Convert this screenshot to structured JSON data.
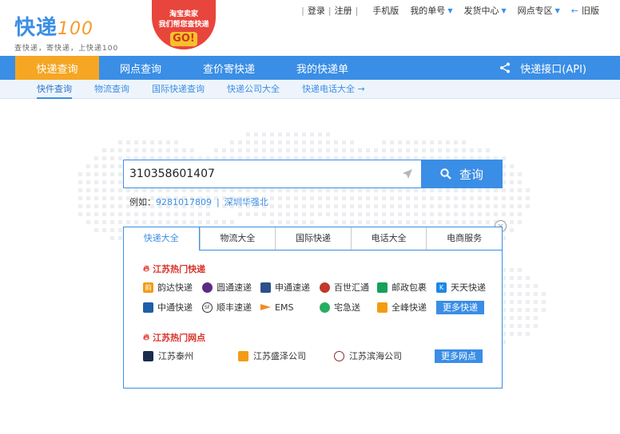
{
  "logo": {
    "main": "快递",
    "num": "100",
    "tagline": "查快递，寄快递，上快递100"
  },
  "promo": {
    "line1": "淘宝卖家",
    "line2": "我们帮您查快递",
    "go": "GO!"
  },
  "topbar": {
    "login": "登录",
    "register": "注册",
    "mobile": "手机版",
    "my_orders": "我的单号",
    "sender_center": "发货中心",
    "outlet_zone": "网点专区",
    "old_version": "旧版"
  },
  "nav": {
    "tabs": [
      "快递查询",
      "网点查询",
      "查价寄快递",
      "我的快递单"
    ],
    "api": "快递接口(API)"
  },
  "subnav": [
    "快件查询",
    "物流查询",
    "国际快递查询",
    "快递公司大全",
    "快递电话大全 →"
  ],
  "search": {
    "value": "310358601407",
    "button": "查询"
  },
  "example": {
    "label": "例如：",
    "number": "9281017809",
    "place": "深圳华强北"
  },
  "panel": {
    "close": "×",
    "tabs": [
      "快递大全",
      "物流大全",
      "国际快递",
      "电话大全",
      "电商服务"
    ],
    "hot_express_title": "江苏热门快递",
    "companies": [
      "韵达快递",
      "圆通速递",
      "申通速递",
      "百世汇通",
      "邮政包裹",
      "天天快递",
      "中通快递",
      "顺丰速递",
      "EMS",
      "宅急送",
      "全峰快递"
    ],
    "more_express": "更多快递",
    "hot_outlets_title": "江苏热门网点",
    "outlets": [
      "江苏泰州",
      "江苏盛泽公司",
      "江苏滨海公司"
    ],
    "more_outlets": "更多网点"
  },
  "colors": {
    "brand_blue": "#3a8ee6",
    "accent_orange": "#f5a623",
    "hot_red": "#d9322b"
  }
}
